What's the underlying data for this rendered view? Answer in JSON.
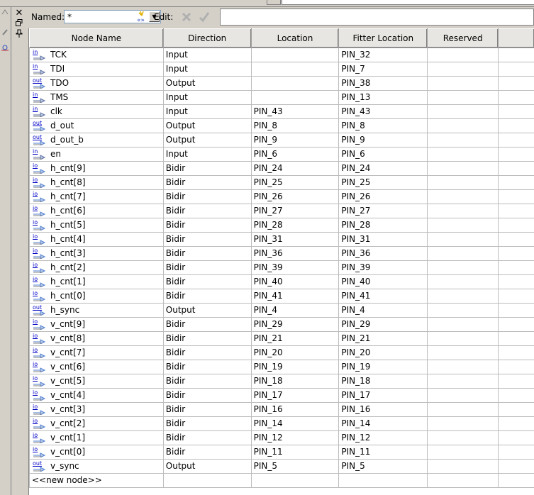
{
  "toolbar": {
    "named_label": "Named:",
    "named_value": "*",
    "edit_label": "Edit:"
  },
  "table": {
    "columns": [
      "Node Name",
      "Direction",
      "Location",
      "Fitter Location",
      "Reserved"
    ],
    "rows": [
      {
        "type": "in",
        "name": "TCK",
        "direction": "Input",
        "location": "",
        "fitter_location": "PIN_32",
        "reserved": ""
      },
      {
        "type": "in",
        "name": "TDI",
        "direction": "Input",
        "location": "",
        "fitter_location": "PIN_7",
        "reserved": ""
      },
      {
        "type": "out",
        "name": "TDO",
        "direction": "Output",
        "location": "",
        "fitter_location": "PIN_38",
        "reserved": ""
      },
      {
        "type": "in",
        "name": "TMS",
        "direction": "Input",
        "location": "",
        "fitter_location": "PIN_13",
        "reserved": ""
      },
      {
        "type": "in",
        "name": "clk",
        "direction": "Input",
        "location": "PIN_43",
        "fitter_location": "PIN_43",
        "reserved": ""
      },
      {
        "type": "out",
        "name": "d_out",
        "direction": "Output",
        "location": "PIN_8",
        "fitter_location": "PIN_8",
        "reserved": ""
      },
      {
        "type": "out",
        "name": "d_out_b",
        "direction": "Output",
        "location": "PIN_9",
        "fitter_location": "PIN_9",
        "reserved": ""
      },
      {
        "type": "in",
        "name": "en",
        "direction": "Input",
        "location": "PIN_6",
        "fitter_location": "PIN_6",
        "reserved": ""
      },
      {
        "type": "io",
        "name": "h_cnt[9]",
        "direction": "Bidir",
        "location": "PIN_24",
        "fitter_location": "PIN_24",
        "reserved": ""
      },
      {
        "type": "io",
        "name": "h_cnt[8]",
        "direction": "Bidir",
        "location": "PIN_25",
        "fitter_location": "PIN_25",
        "reserved": ""
      },
      {
        "type": "io",
        "name": "h_cnt[7]",
        "direction": "Bidir",
        "location": "PIN_26",
        "fitter_location": "PIN_26",
        "reserved": ""
      },
      {
        "type": "io",
        "name": "h_cnt[6]",
        "direction": "Bidir",
        "location": "PIN_27",
        "fitter_location": "PIN_27",
        "reserved": ""
      },
      {
        "type": "io",
        "name": "h_cnt[5]",
        "direction": "Bidir",
        "location": "PIN_28",
        "fitter_location": "PIN_28",
        "reserved": ""
      },
      {
        "type": "io",
        "name": "h_cnt[4]",
        "direction": "Bidir",
        "location": "PIN_31",
        "fitter_location": "PIN_31",
        "reserved": ""
      },
      {
        "type": "io",
        "name": "h_cnt[3]",
        "direction": "Bidir",
        "location": "PIN_36",
        "fitter_location": "PIN_36",
        "reserved": ""
      },
      {
        "type": "io",
        "name": "h_cnt[2]",
        "direction": "Bidir",
        "location": "PIN_39",
        "fitter_location": "PIN_39",
        "reserved": ""
      },
      {
        "type": "io",
        "name": "h_cnt[1]",
        "direction": "Bidir",
        "location": "PIN_40",
        "fitter_location": "PIN_40",
        "reserved": ""
      },
      {
        "type": "io",
        "name": "h_cnt[0]",
        "direction": "Bidir",
        "location": "PIN_41",
        "fitter_location": "PIN_41",
        "reserved": ""
      },
      {
        "type": "out",
        "name": "h_sync",
        "direction": "Output",
        "location": "PIN_4",
        "fitter_location": "PIN_4",
        "reserved": ""
      },
      {
        "type": "io",
        "name": "v_cnt[9]",
        "direction": "Bidir",
        "location": "PIN_29",
        "fitter_location": "PIN_29",
        "reserved": ""
      },
      {
        "type": "io",
        "name": "v_cnt[8]",
        "direction": "Bidir",
        "location": "PIN_21",
        "fitter_location": "PIN_21",
        "reserved": ""
      },
      {
        "type": "io",
        "name": "v_cnt[7]",
        "direction": "Bidir",
        "location": "PIN_20",
        "fitter_location": "PIN_20",
        "reserved": ""
      },
      {
        "type": "io",
        "name": "v_cnt[6]",
        "direction": "Bidir",
        "location": "PIN_19",
        "fitter_location": "PIN_19",
        "reserved": ""
      },
      {
        "type": "io",
        "name": "v_cnt[5]",
        "direction": "Bidir",
        "location": "PIN_18",
        "fitter_location": "PIN_18",
        "reserved": ""
      },
      {
        "type": "io",
        "name": "v_cnt[4]",
        "direction": "Bidir",
        "location": "PIN_17",
        "fitter_location": "PIN_17",
        "reserved": ""
      },
      {
        "type": "io",
        "name": "v_cnt[3]",
        "direction": "Bidir",
        "location": "PIN_16",
        "fitter_location": "PIN_16",
        "reserved": ""
      },
      {
        "type": "io",
        "name": "v_cnt[2]",
        "direction": "Bidir",
        "location": "PIN_14",
        "fitter_location": "PIN_14",
        "reserved": ""
      },
      {
        "type": "io",
        "name": "v_cnt[1]",
        "direction": "Bidir",
        "location": "PIN_12",
        "fitter_location": "PIN_12",
        "reserved": ""
      },
      {
        "type": "io",
        "name": "v_cnt[0]",
        "direction": "Bidir",
        "location": "PIN_11",
        "fitter_location": "PIN_11",
        "reserved": ""
      },
      {
        "type": "out",
        "name": "v_sync",
        "direction": "Output",
        "location": "PIN_5",
        "fitter_location": "PIN_5",
        "reserved": ""
      }
    ],
    "new_node_label": "<<new node>>"
  },
  "icons": {
    "close": "close-icon",
    "float": "float-window-icon",
    "pin": "pushpin-icon",
    "filter": "filter-nodes-icon",
    "cancel": "cancel-edit-icon",
    "accept": "accept-edit-icon",
    "pin_type_labels": {
      "in": "in",
      "out": "out",
      "io": "io"
    }
  },
  "colors": {
    "window_bg": "#d4d0c8",
    "grid_line": "#bcbcbc",
    "pin_icon_text": "#0000c8"
  }
}
